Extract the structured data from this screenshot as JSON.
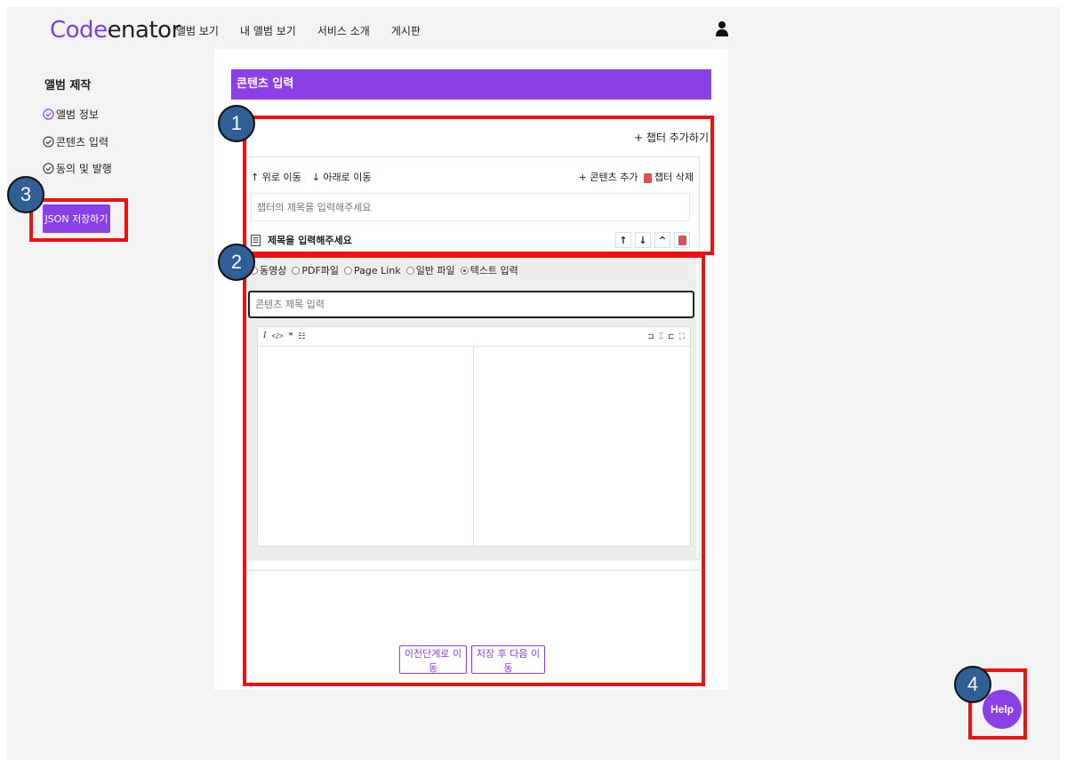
{
  "header": {
    "logo_part1": "Code",
    "logo_part2": "enator",
    "nav": [
      "앨범 보기",
      "내 앨범 보기",
      "서비스 소개",
      "게시판"
    ]
  },
  "sidebar": {
    "title": "앨범 제작",
    "steps": [
      "앨범 정보",
      "콘텐츠 입력",
      "동의 및 발행"
    ],
    "json_button": "JSON 저장하기"
  },
  "main": {
    "title": "콘텐츠 입력",
    "add_chapter": "+ 챕터 추가하기",
    "move_up": "↑ 위로 이동",
    "move_down": "↓ 아래로 이동",
    "add_content": "+ 콘텐츠 추가",
    "delete_chapter": "챕터 삭제",
    "chapter_title_placeholder": "챕터의 제목을 입력해주세요",
    "content_title": "제목을 입력해주세요",
    "content_types": [
      "동영상",
      "PDF파일",
      "Page Link",
      "일반 파일",
      "텍스트 입력"
    ],
    "selected_type": "텍스트 입력",
    "content_title_placeholder": "콘텐츠 제목 입력",
    "prev_button": "이전단계로 이동",
    "next_button": "저장 후 다음 이동"
  },
  "help_button": "Help",
  "annotations": [
    "1",
    "2",
    "3",
    "4"
  ],
  "colors": {
    "accent": "#8b3fe6",
    "highlight": "#ee1111",
    "badge": "#2f5f95"
  }
}
